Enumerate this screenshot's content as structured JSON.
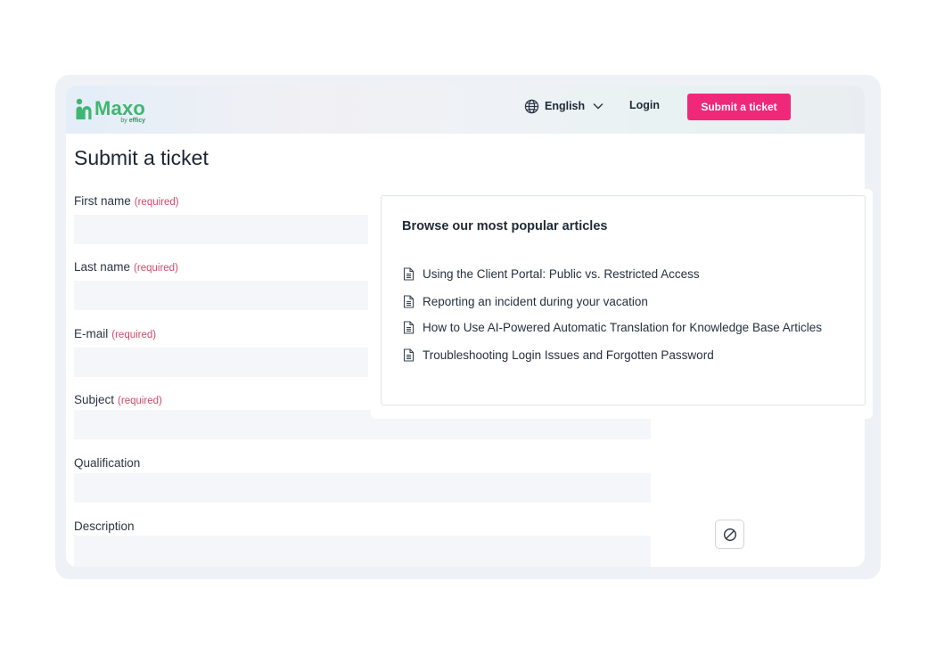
{
  "header": {
    "logo": {
      "name": "Maxo",
      "sub_prefix": "by",
      "sub_brand": "efficy"
    },
    "language": {
      "label": "English"
    },
    "login_label": "Login",
    "submit_label": "Submit a ticket"
  },
  "page": {
    "title": "Submit a ticket"
  },
  "form": {
    "required_text": "(required)",
    "fields": [
      {
        "label": "First name",
        "required": true,
        "value": ""
      },
      {
        "label": "Last name",
        "required": true,
        "value": ""
      },
      {
        "label": "E-mail",
        "required": true,
        "value": ""
      },
      {
        "label": "Subject",
        "required": true,
        "value": ""
      },
      {
        "label": "Qualification",
        "required": false,
        "value": ""
      },
      {
        "label": "Description",
        "required": false,
        "value": ""
      }
    ]
  },
  "articles": {
    "title": "Browse our most popular articles",
    "items": [
      "Using the Client Portal: Public vs. Restricted Access",
      "Reporting an incident during your vacation",
      "How to Use AI-Powered Automatic Translation for Knowledge Base Articles",
      "Troubleshooting Login Issues and Forgotten Password"
    ]
  },
  "colors": {
    "brand_green": "#3fb671",
    "accent_pink": "#f0287a",
    "required_red": "#d04a6a"
  },
  "icons": {
    "language": "globe-icon",
    "dropdown": "chevron-down-icon",
    "article": "document-icon",
    "floating_action": "prohibited-icon"
  }
}
